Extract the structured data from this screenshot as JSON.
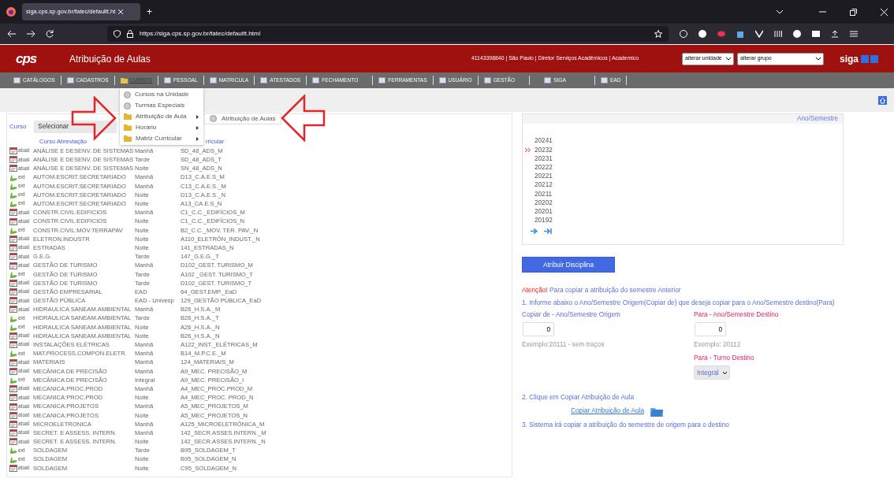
{
  "browser": {
    "tab_title": "siga.cps.sp.gov.br/fatec/defaultt.ht",
    "new_tab": "+",
    "url": "https://siga.cps.sp.gov.br/fatec/defaultt.html"
  },
  "header": {
    "logo": "cps",
    "title": "Atribuição de Aulas",
    "user_info": "41143398840 | São Paulo | Diretor Serviços Acadêmicos | Academico",
    "unit_select": "alterar unidade",
    "group_select": "alterar grupo",
    "brand": "siga"
  },
  "menu": [
    {
      "label": "CATÁLOGOS",
      "selected": false
    },
    {
      "label": "CADASTROS",
      "selected": false
    },
    {
      "label": "CURSOS",
      "selected": true
    },
    {
      "label": "PESSOAL",
      "selected": false
    },
    {
      "label": "MATRICULA",
      "selected": false
    },
    {
      "label": "ATESTADOS",
      "selected": false
    },
    {
      "label": "FECHAMENTO",
      "selected": false
    },
    {
      "label": "FERRAMENTAS",
      "selected": false
    },
    {
      "label": "USUÁRIO",
      "selected": false
    },
    {
      "label": "GESTÃO",
      "selected": false
    },
    {
      "label": "SIGA",
      "selected": false
    },
    {
      "label": "EAD",
      "selected": false
    }
  ],
  "dropdown": {
    "items": [
      {
        "label": "Cursos na Unidade",
        "kind": "leaf"
      },
      {
        "label": "Turmas Especiais",
        "kind": "leaf"
      },
      {
        "label": "Atribuição de Aula",
        "kind": "folder"
      },
      {
        "label": "Horário",
        "kind": "folder"
      },
      {
        "label": "Matriz Curricular",
        "kind": "folder"
      }
    ],
    "submenu": [
      {
        "label": "Atribuição de Aulas"
      }
    ]
  },
  "course_filter": {
    "label": "Curso",
    "value": "Selecionar"
  },
  "table": {
    "column_headers": {
      "course": "Curso Abreviação",
      "column_3": "rricular"
    },
    "rows": [
      {
        "kind": "atual",
        "tag": "atual",
        "course": "ANÁLISE E DESENV. DE SISTEMAS",
        "period": "Manhã",
        "code": "SD_48_ADS_M"
      },
      {
        "kind": "atual",
        "tag": "atual",
        "course": "ANÁLISE E DESENV. DE SISTEMAS",
        "period": "Tarde",
        "code": "SD_48_ADS_T"
      },
      {
        "kind": "atual",
        "tag": "atual",
        "course": "ANÁLISE E DESENV. DE SISTEMAS",
        "period": "Noite",
        "code": "SN_48_ADS_N"
      },
      {
        "kind": "ext",
        "tag": "ext",
        "course": "AUTOM.ESCRIT.SECRETARIADO",
        "period": "Manhã",
        "code": "D13_C.A.E.S_M"
      },
      {
        "kind": "ext",
        "tag": "ext",
        "course": "AUTOM.ESCRIT.SECRETARIADO",
        "period": "Manhã",
        "code": "C13_C.A.E.S._M"
      },
      {
        "kind": "ext",
        "tag": "ext",
        "course": "AUTOM.ESCRIT.SECRETARIADO",
        "period": "Noite",
        "code": "D13_C.A.E.S._N"
      },
      {
        "kind": "ext",
        "tag": "ext",
        "course": "AUTOM.ESCRIT.SECRETARIADO",
        "period": "Noite",
        "code": "A13_CA.E.S_N"
      },
      {
        "kind": "atual",
        "tag": "atual",
        "course": "CONSTR.CIVIL:EDIFICIOS",
        "period": "Manhã",
        "code": "C1_C.C._EDIFÍCIOS_M"
      },
      {
        "kind": "atual",
        "tag": "atual",
        "course": "CONSTR.CIVIL:EDIFICIOS",
        "period": "Noite",
        "code": "C1_C.C._EDIFÍCIOS_N"
      },
      {
        "kind": "ext",
        "tag": "ext",
        "course": "CONSTR.CIVIL:MOV.TERRAPAV",
        "period": "Noite",
        "code": "B2_C.C._MOV. TER. PAV._N"
      },
      {
        "kind": "atual",
        "tag": "atual",
        "course": "ELETRON.INDUSTR",
        "period": "Noite",
        "code": "A110_ELETRÔN_INDUST._N"
      },
      {
        "kind": "atual",
        "tag": "atual",
        "course": "ESTRADAS",
        "period": "Noite",
        "code": "141_ESTRADAS_N"
      },
      {
        "kind": "atual",
        "tag": "atual",
        "course": "G.E.G.",
        "period": "Tarde",
        "code": "147_G.E.G._T"
      },
      {
        "kind": "atual",
        "tag": "atual",
        "course": "GESTÃO DE TURISMO",
        "period": "Manhã",
        "code": "D102_GEST. TURISMO_M"
      },
      {
        "kind": "ext",
        "tag": "ext",
        "course": "GESTÃO DE TURISMO",
        "period": "Tarde",
        "code": "A102 _GEST. TURISMO_T"
      },
      {
        "kind": "atual",
        "tag": "atual",
        "course": "GESTÃO DE TURISMO",
        "period": "Tarde",
        "code": "D102_GEST. TURISMO_T"
      },
      {
        "kind": "atual",
        "tag": "atual",
        "course": "GESTÃO EMPRESARIAL",
        "period": "EAD",
        "code": "64_GEST.EMP._EaD"
      },
      {
        "kind": "atual",
        "tag": "atual",
        "course": "GESTÃO PÚBLICA",
        "period": "EAD - Univesp",
        "code": "129_GESTÃO PÚBLICA_EaD"
      },
      {
        "kind": "atual",
        "tag": "atual",
        "course": "HIDRAULICA SANEAM.AMBIENTAL",
        "period": "Manhã",
        "code": "B26_H.S.A._M"
      },
      {
        "kind": "ext",
        "tag": "ext",
        "course": "HIDRAULICA SANEAM.AMBIENTAL",
        "period": "Tarde",
        "code": "B26_H.S.A._T"
      },
      {
        "kind": "ext",
        "tag": "ext",
        "course": "HIDRAULICA SANEAM.AMBIENTAL",
        "period": "Noite",
        "code": "A26_H.S.A._N"
      },
      {
        "kind": "atual",
        "tag": "atual",
        "course": "HIDRAULICA SANEAM.AMBIENTAL",
        "period": "Noite",
        "code": "B26_H.S.A._N"
      },
      {
        "kind": "atual",
        "tag": "atual",
        "course": "INSTALAÇÕES ELÉTRICAS",
        "period": "Manhã",
        "code": "A122_INST._ELÉTRICAS_M"
      },
      {
        "kind": "ext",
        "tag": "ext",
        "course": "MAT.PROCESS.COMPON.ELETR.",
        "period": "Manhã",
        "code": "B14_M.P.C.E._M"
      },
      {
        "kind": "atual",
        "tag": "atual",
        "course": "MATERIAIS",
        "period": "Manhã",
        "code": "124_MATERIAIS_M"
      },
      {
        "kind": "atual",
        "tag": "atual",
        "course": "MECÂNICA DE PRECISÃO",
        "period": "Manhã",
        "code": "A9_MEC. PRECISÃO_M"
      },
      {
        "kind": "ext",
        "tag": "ext",
        "course": "MECÂNICA DE PRECISÃO",
        "period": "Integral",
        "code": "A9_MEC. PRECISÃO_I"
      },
      {
        "kind": "atual",
        "tag": "atual",
        "course": "MECANICA:PROC.PROD",
        "period": "Manhã",
        "code": "A4_MEC_PROC.PROD_M"
      },
      {
        "kind": "atual",
        "tag": "atual",
        "course": "MECANICA:PROC.PROD",
        "period": "Noite",
        "code": "A4_MEC_PROC. PROD_N"
      },
      {
        "kind": "atual",
        "tag": "atual",
        "course": "MECANICA:PROJETOS",
        "period": "Manhã",
        "code": "A5_MEC_PROJETOS_M"
      },
      {
        "kind": "atual",
        "tag": "atual",
        "course": "MECANICA:PROJETOS",
        "period": "Noite",
        "code": "A5_MEC_PROJETOS_N"
      },
      {
        "kind": "atual",
        "tag": "atual",
        "course": "MICROELETRONICA",
        "period": "Manhã",
        "code": "A125_MICROELETRÔNICA_M"
      },
      {
        "kind": "atual",
        "tag": "atual",
        "course": "SECRET. E ASSESS. INTERN.",
        "period": "Manhã",
        "code": "142_SECR.ASSES.INTERN._M"
      },
      {
        "kind": "atual",
        "tag": "atual",
        "course": "SECRET. E ASSESS. INTERN.",
        "period": "Noite",
        "code": "142_SECR.ASSES.INTERN._N"
      },
      {
        "kind": "ext",
        "tag": "ext",
        "course": "SOLDAGEM",
        "period": "Tarde",
        "code": "B95_SOLDAGEM_T"
      },
      {
        "kind": "ext",
        "tag": "ext",
        "course": "SOLDAGEM",
        "period": "Noite",
        "code": "B95_SOLDAGEM_N"
      },
      {
        "kind": "atual",
        "tag": "atual",
        "course": "SOLDAGEM",
        "period": "Noite",
        "code": "C95_SOLDAGEM_N"
      }
    ]
  },
  "semesters": {
    "header": "Ano/Semestre",
    "items": [
      {
        "label": "20241",
        "selected": false
      },
      {
        "label": "20232",
        "selected": true
      },
      {
        "label": "20231",
        "selected": false
      },
      {
        "label": "20222",
        "selected": false
      },
      {
        "label": "20221",
        "selected": false
      },
      {
        "label": "20212",
        "selected": false
      },
      {
        "label": "20211",
        "selected": false
      },
      {
        "label": "20202",
        "selected": false
      },
      {
        "label": "20201",
        "selected": false
      },
      {
        "label": "20192",
        "selected": false
      }
    ]
  },
  "assign_button": "Atribuir Disciplina",
  "copy": {
    "attention": "Atenção!",
    "intro": "Para copiar a atribuição do semestre Anterior",
    "step_1": "1. Informe abaixo o Ano/Semestre Origem(Copiar de) que deseja copiar para o Ano/Semestre destino(Para)",
    "origin_label": "Copiar de - Ano/Semestre Origem",
    "origin_value": "0",
    "origin_hint": "Exemplo:20111 - sem traços",
    "dest_label": "Para - Ano/Semestre Destino",
    "dest_value": "0",
    "dest_hint": "Exemplo: 20112",
    "shift_label": "Para - Turno Destino",
    "shift_value": "Integral",
    "step_2": "2. Clique em Copiar Atribuição de Aula",
    "copy_link": "Copiar Atribuição de Aula",
    "step_3": "3. Sistema irá copiar a atribuição do semestre de origem para o destino"
  }
}
